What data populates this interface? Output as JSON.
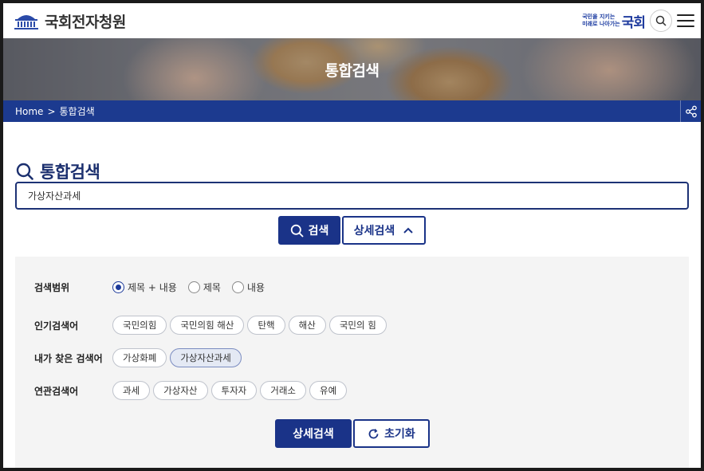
{
  "header": {
    "site_name": "국회전자청원",
    "slogan_line1": "국민을 지키는",
    "slogan_line2": "미래로 나아가는",
    "slogan_brand": "국회"
  },
  "banner": {
    "title": "통합검색"
  },
  "breadcrumb": {
    "home": "Home",
    "separator": ">",
    "current": "통합검색"
  },
  "search": {
    "title": "통합검색",
    "query": "가상자산과세",
    "search_button": "검색",
    "advanced_button": "상세검색"
  },
  "advanced": {
    "scope": {
      "label": "검색범위",
      "options": [
        "제목 + 내용",
        "제목",
        "내용"
      ],
      "selected": "제목 + 내용"
    },
    "popular": {
      "label": "인기검색어",
      "items": [
        "국민의힘",
        "국민의힘 해산",
        "탄핵",
        "해산",
        "국민의 힘"
      ]
    },
    "history": {
      "label": "내가 찾은 검색어",
      "items": [
        "가상화폐",
        "가상자산과세"
      ],
      "active": "가상자산과세"
    },
    "related": {
      "label": "연관검색어",
      "items": [
        "과세",
        "가상자산",
        "투자자",
        "거래소",
        "유예"
      ]
    },
    "submit_button": "상세검색",
    "reset_button": "초기화"
  },
  "colors": {
    "brand_navy": "#1a3388",
    "breadcrumb_bar": "#1c3a8f",
    "panel_bg": "#f4f4f4"
  }
}
